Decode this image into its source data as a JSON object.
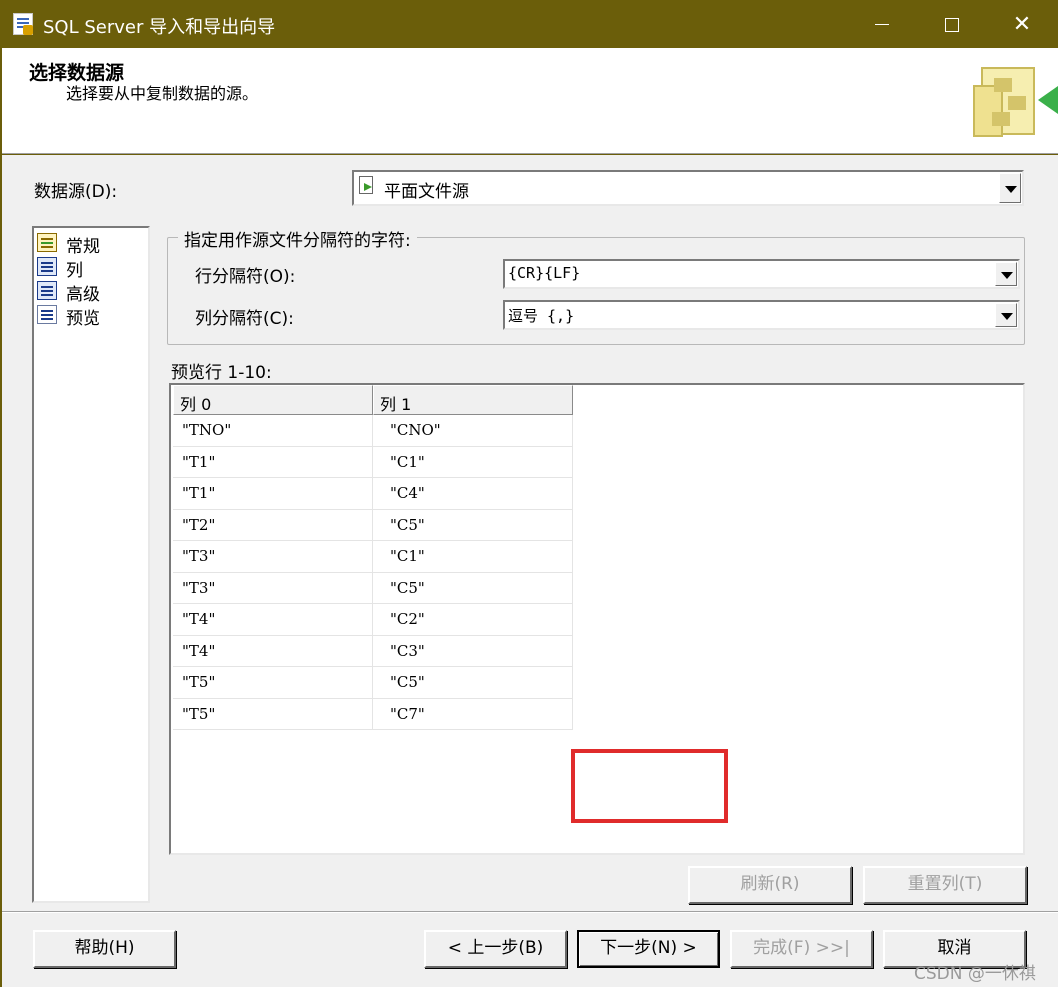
{
  "window": {
    "title": "SQL Server 导入和导出向导",
    "controls": {
      "minimize": "—",
      "maximize": "☐",
      "close": "✕"
    }
  },
  "header": {
    "title": "选择数据源",
    "subtitle": "选择要从中复制数据的源。"
  },
  "datasource": {
    "label": "数据源(D):",
    "value": "平面文件源",
    "icon": "flat-file-source-icon"
  },
  "nav": {
    "items": [
      {
        "label": "常规",
        "icon": "general-icon"
      },
      {
        "label": "列",
        "icon": "columns-icon"
      },
      {
        "label": "高级",
        "icon": "advanced-icon"
      },
      {
        "label": "预览",
        "icon": "preview-icon"
      }
    ]
  },
  "delimiters": {
    "group_title": "指定用作源文件分隔符的字符:",
    "row_label": "行分隔符(O):",
    "row_value": "{CR}{LF}",
    "col_label": "列分隔符(C):",
    "col_value": "逗号 {,}"
  },
  "preview": {
    "label": "预览行 1-10:",
    "columns": [
      "列 0",
      "列 1"
    ],
    "rows": [
      [
        "\"TNO\"",
        "\"CNO\""
      ],
      [
        "\"T1\"",
        "\"C1\""
      ],
      [
        "\"T1\"",
        "\"C4\""
      ],
      [
        "\"T2\"",
        "\"C5\""
      ],
      [
        "\"T3\"",
        "\"C1\""
      ],
      [
        "\"T3\"",
        "\"C5\""
      ],
      [
        "\"T4\"",
        "\"C2\""
      ],
      [
        "\"T4\"",
        "\"C3\""
      ],
      [
        "\"T5\"",
        "\"C5\""
      ],
      [
        "\"T5\"",
        "\"C7\""
      ]
    ]
  },
  "buttons": {
    "refresh": "刷新(R)",
    "reset_columns": "重置列(T)",
    "help": "帮助(H)",
    "back": "< 上一步(B)",
    "next": "下一步(N) >",
    "finish": "完成(F) >>|",
    "cancel": "取消"
  },
  "watermark": "CSDN @一休祺",
  "colors": {
    "titlebar": "#6b5e0a",
    "highlight": "#e02b2b"
  }
}
